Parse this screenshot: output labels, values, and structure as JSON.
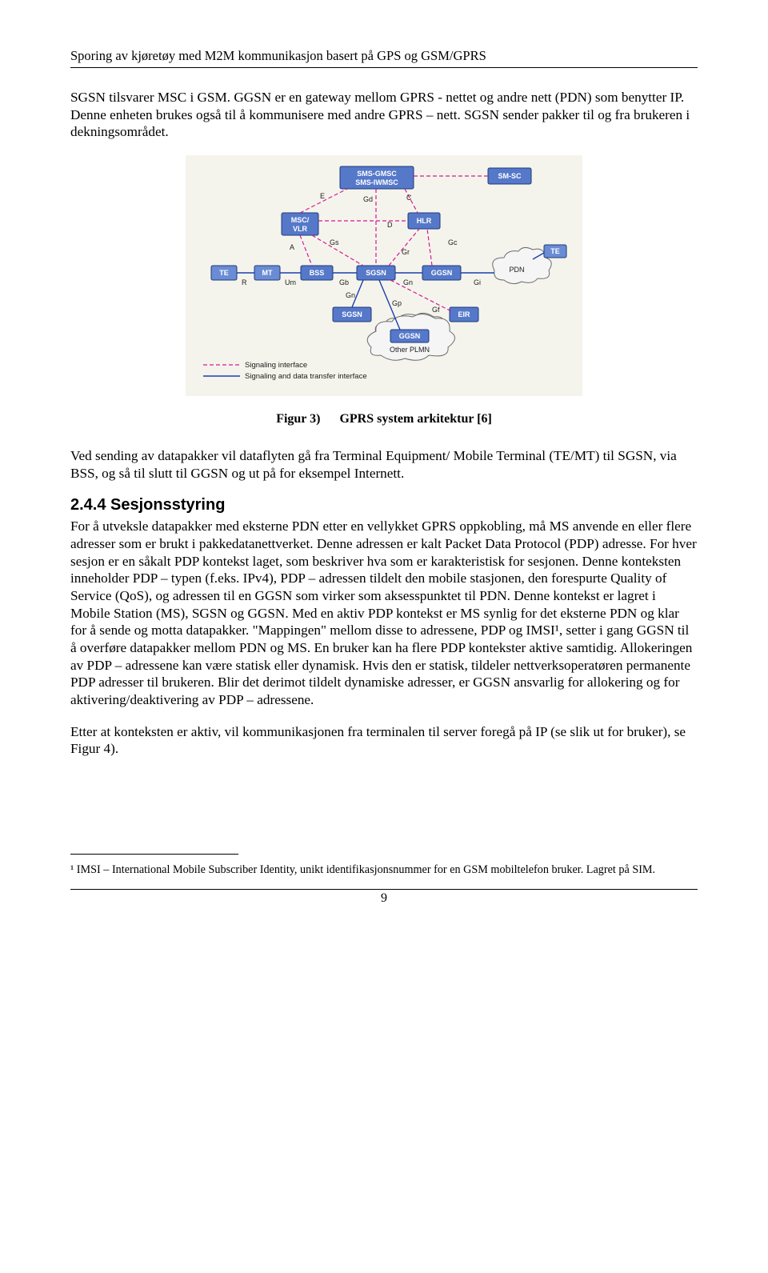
{
  "header": {
    "running": "Sporing av kjøretøy med M2M kommunikasjon basert på GPS og GSM/GPRS"
  },
  "paragraphs": {
    "p1": "SGSN tilsvarer MSC i GSM. GGSN er en gateway mellom GPRS - nettet og andre nett (PDN) som benytter IP. Denne enheten brukes også til å kommunisere med andre GPRS – nett. SGSN sender pakker til og fra brukeren i dekningsområdet.",
    "p2": "Ved sending av datapakker vil dataflyten gå fra Terminal Equipment/ Mobile Terminal (TE/MT) til SGSN, via BSS, og så til slutt til GGSN og ut på for eksempel Internett.",
    "p3": "For å utveksle datapakker med eksterne PDN etter en vellykket GPRS oppkobling, må MS anvende en eller flere adresser som er brukt i pakkedatanettverket. Denne adressen er kalt Packet Data Protocol (PDP) adresse. For hver sesjon er en såkalt PDP kontekst laget, som beskriver hva som er karakteristisk for sesjonen. Denne konteksten inneholder PDP – typen (f.eks. IPv4), PDP – adressen tildelt den mobile stasjonen, den forespurte Quality of Service (QoS), og adressen til en GGSN som virker som aksesspunktet til PDN. Denne kontekst er lagret i Mobile Station (MS), SGSN og GGSN. Med en aktiv PDP kontekst er MS synlig for det eksterne PDN og klar for å sende og motta datapakker. \"Mappingen\" mellom disse to adressene, PDP og IMSI¹, setter i gang GGSN til å overføre datapakker mellom PDN og MS. En bruker kan ha flere PDP kontekster aktive samtidig. Allokeringen av PDP – adressene kan være statisk eller dynamisk. Hvis den er statisk, tildeler nettverksoperatøren permanente PDP adresser til brukeren. Blir det derimot tildelt dynamiske adresser, er GGSN ansvarlig for allokering og for aktivering/deaktivering av PDP – adressene.",
    "p4": "Etter at konteksten er aktiv, vil kommunikasjonen fra terminalen til server foregå på IP (se slik ut for bruker), se Figur 4)."
  },
  "figure": {
    "caption_label": "Figur 3)",
    "caption_text": "GPRS system arkitektur [6]",
    "nodes": {
      "sms": "SMS-GMSC\nSMS-IWMSC",
      "smsc": "SM-SC",
      "mscvlr": "MSC/\nVLR",
      "hlr": "HLR",
      "te1": "TE",
      "mt": "MT",
      "bss": "BSS",
      "sgsn": "SGSN",
      "ggsn": "GGSN",
      "pdn": "PDN",
      "te2": "TE",
      "sgsn2": "SGSN",
      "eir": "EIR",
      "ggsn2": "GGSN",
      "plmn": "Other PLMN"
    },
    "iface": {
      "e": "E",
      "gd": "Gd",
      "c": "C",
      "d": "D",
      "a": "A",
      "gs": "Gs",
      "gr": "Gr",
      "gc": "Gc",
      "r": "R",
      "um": "Um",
      "gb": "Gb",
      "gn": "Gn",
      "gi": "Gi",
      "gn2": "Gn",
      "gp": "Gp",
      "gf": "Gf"
    },
    "legend": {
      "sig": "Signaling interface",
      "data": "Signaling and data transfer interface"
    }
  },
  "section": {
    "heading": "2.4.4  Sesjonsstyring"
  },
  "footnote": {
    "text": "¹ IMSI – International Mobile Subscriber Identity, unikt identifikasjonsnummer for en GSM mobiltelefon bruker. Lagret på SIM."
  },
  "page_number": "9"
}
